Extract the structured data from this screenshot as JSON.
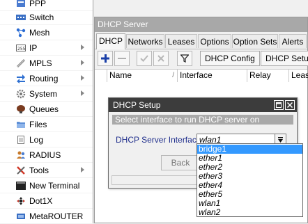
{
  "sidebar": {
    "items": [
      {
        "label": "PPP",
        "icon": "ppp-icon"
      },
      {
        "label": "Switch",
        "icon": "switch-icon"
      },
      {
        "label": "Mesh",
        "icon": "mesh-icon"
      },
      {
        "label": "IP",
        "icon": "ip-icon",
        "submenu": true
      },
      {
        "label": "MPLS",
        "icon": "mpls-icon",
        "submenu": true
      },
      {
        "label": "Routing",
        "icon": "routing-icon",
        "submenu": true
      },
      {
        "label": "System",
        "icon": "system-gear-icon",
        "submenu": true
      },
      {
        "label": "Queues",
        "icon": "queues-icon"
      },
      {
        "label": "Files",
        "icon": "files-folder-icon"
      },
      {
        "label": "Log",
        "icon": "log-icon"
      },
      {
        "label": "RADIUS",
        "icon": "radius-users-icon"
      },
      {
        "label": "Tools",
        "icon": "tools-icon",
        "submenu": true
      },
      {
        "label": "New Terminal",
        "icon": "terminal-icon"
      },
      {
        "label": "Dot1X",
        "icon": "dot1x-icon"
      },
      {
        "label": "MetaROUTER",
        "icon": "metarouter-icon"
      }
    ]
  },
  "window": {
    "title": "DHCP Server",
    "tabs": [
      "DHCP",
      "Networks",
      "Leases",
      "Options",
      "Option Sets",
      "Alerts"
    ],
    "active_tab": "DHCP",
    "toolbar": {
      "add_icon": "plus-icon",
      "remove_icon": "minus-icon",
      "enable_icon": "check-icon",
      "disable_icon": "cross-icon",
      "filter_icon": "filter-icon",
      "dhcp_config": "DHCP Config",
      "dhcp_setup": "DHCP Setup"
    },
    "columns": [
      "Name",
      "Interface",
      "Relay",
      "Lease"
    ]
  },
  "dialog": {
    "title": "DHCP Setup",
    "hint": "Select interface to run DHCP server on",
    "field_label": "DHCP Server Interface:",
    "field_value": "wlan1",
    "back_label": "Back",
    "options": [
      "bridge1",
      "ether1",
      "ether2",
      "ether3",
      "ether4",
      "ether5",
      "wlan1",
      "wlan2"
    ],
    "highlighted_option": "bridge1"
  },
  "colors": {
    "accent_blue": "#3399ff",
    "title_bar_dark": "#3c3c3c",
    "window_title_gray": "#a8a8a8",
    "label_blue": "#1f2e8c"
  }
}
